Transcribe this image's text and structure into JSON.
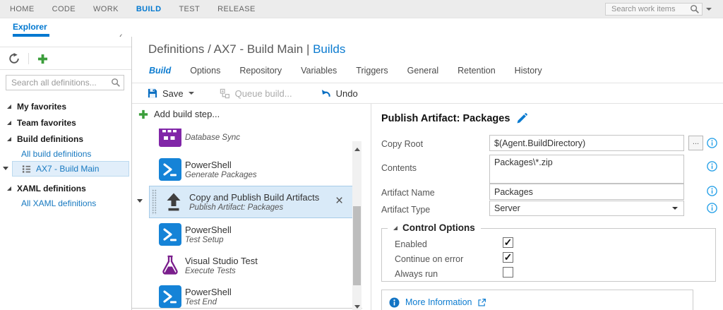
{
  "topnav": {
    "items": [
      "HOME",
      "CODE",
      "WORK",
      "BUILD",
      "TEST",
      "RELEASE"
    ],
    "active": "BUILD",
    "search_placeholder": "Search work items"
  },
  "subnav": {
    "tab": "Explorer"
  },
  "sidebar": {
    "search_placeholder": "Search all definitions...",
    "tree": {
      "my_favorites": "My favorites",
      "team_favorites": "Team favorites",
      "build_definitions": "Build definitions",
      "all_build_definitions": "All build definitions",
      "selected_definition": "AX7 - Build Main",
      "xaml_definitions": "XAML definitions",
      "all_xaml_definitions": "All XAML definitions"
    }
  },
  "header": {
    "breadcrumb": "Definitions / AX7 - Build Main | ",
    "breadcrumb_link": "Builds",
    "tabs": [
      "Build",
      "Options",
      "Repository",
      "Variables",
      "Triggers",
      "General",
      "Retention",
      "History"
    ],
    "active_tab": "Build"
  },
  "toolbar": {
    "save": "Save",
    "queue_build": "Queue build...",
    "undo": "Undo"
  },
  "steps": {
    "add_step": "Add build step...",
    "close_glyph": "×",
    "items": [
      {
        "subtitle": "Database Sync",
        "icon": "database-sync"
      },
      {
        "title": "PowerShell",
        "subtitle": "Generate Packages",
        "icon": "powershell"
      },
      {
        "title": "Copy and Publish Build Artifacts",
        "subtitle": "Publish Artifact: Packages",
        "icon": "publish-artifact",
        "selected": true
      },
      {
        "title": "PowerShell",
        "subtitle": "Test Setup",
        "icon": "powershell"
      },
      {
        "title": "Visual Studio Test",
        "subtitle": "Execute Tests",
        "icon": "vstest-flask"
      },
      {
        "title": "PowerShell",
        "subtitle": "Test End",
        "icon": "powershell"
      }
    ]
  },
  "panel": {
    "title": "Publish Artifact: Packages",
    "fields": {
      "copy_root": {
        "label": "Copy Root",
        "value": "$(Agent.BuildDirectory)",
        "browse": "..."
      },
      "contents": {
        "label": "Contents",
        "value": "Packages\\*.zip"
      },
      "artifact_name": {
        "label": "Artifact Name",
        "value": "Packages"
      },
      "artifact_type": {
        "label": "Artifact Type",
        "value": "Server"
      }
    },
    "control_options": {
      "title": "Control Options",
      "enabled": {
        "label": "Enabled",
        "mark": "✓"
      },
      "continue_on_error": {
        "label": "Continue on error",
        "mark": "✓"
      },
      "always_run": {
        "label": "Always run",
        "mark": ""
      }
    },
    "more_information": "More Information"
  },
  "colors": {
    "accent_blue": "#0078d0",
    "link_blue": "#1779c0",
    "add_green": "#3b9e3b",
    "powershell_blue": "#1583d7",
    "test_purple": "#7a1e8c",
    "selection_bg": "#d9eaf8",
    "topbar_bg": "#ececec"
  }
}
